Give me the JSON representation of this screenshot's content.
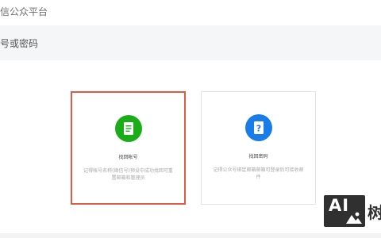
{
  "header": {
    "platform_title": "信公众平台"
  },
  "subheader": {
    "title": "号或密码"
  },
  "options": [
    {
      "title": "找回帐号",
      "description": "记得帐号名称(微信号)预设中成功找回可重置邮箱和管理员",
      "icon": "document-icon",
      "color": "#1aad19",
      "selected": true
    },
    {
      "title": "找回密码",
      "description": "记得公众号绑定邮箱邮箱可登录后可接收邮件",
      "icon": "question-icon",
      "color": "#1a7ce8",
      "selected": false
    }
  ],
  "watermark": {
    "logo_text": "AI",
    "char": "树"
  },
  "colors": {
    "selected_border": "#e05a4a",
    "page_bg": "#ffffff",
    "subheader_bg": "#f5f6f7"
  }
}
